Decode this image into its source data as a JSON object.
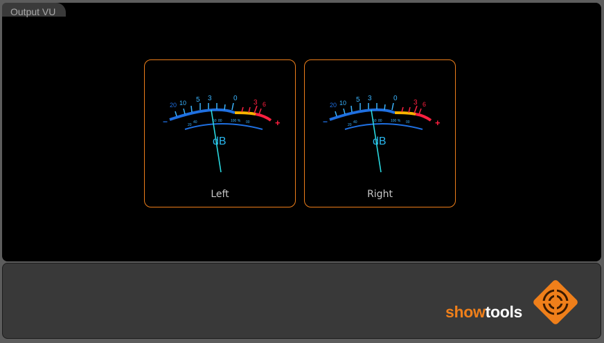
{
  "panel": {
    "tab_label": "Output VU"
  },
  "meters": [
    {
      "label": "Left",
      "needle_angle_deg": -10
    },
    {
      "label": "Right",
      "needle_angle_deg": -10
    }
  ],
  "scale": {
    "upper_labels": [
      "20",
      "10",
      "5",
      "3",
      "0",
      "3",
      "6"
    ],
    "lower_labels": [
      "20",
      "40",
      "60",
      "80",
      "100 %",
      "00"
    ],
    "unit": "dB",
    "minus": "−",
    "plus": "+"
  },
  "brand": {
    "show": "show",
    "tools": "tools"
  },
  "colors": {
    "accent": "#ef7f1a",
    "scale_blue": "#1f6fe0",
    "scale_cyan": "#3ab4ff",
    "needle": "#2ad8e0",
    "scale_red": "#ff2040",
    "scale_yellow": "#ffb400"
  }
}
